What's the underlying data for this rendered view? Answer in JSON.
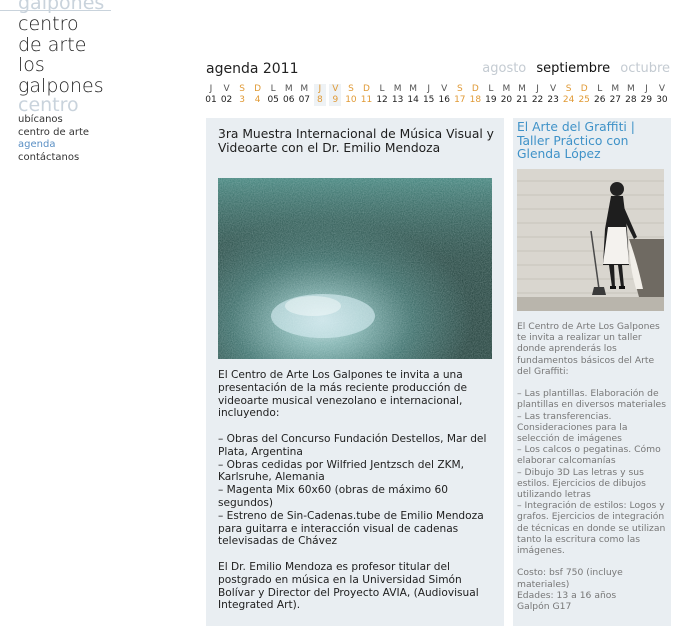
{
  "logo": {
    "ghost_top": "galpones",
    "lines": [
      "centro",
      "de arte",
      "los",
      "galpones"
    ],
    "ghost_bottom": "centro"
  },
  "nav": {
    "items": [
      {
        "label": "ubícanos",
        "active": false
      },
      {
        "label": "centro de arte",
        "active": false
      },
      {
        "label": "agenda",
        "active": true
      },
      {
        "label": "contáctanos",
        "active": false
      }
    ]
  },
  "agenda": {
    "title": "agenda 2011",
    "months": {
      "prev": "agosto",
      "current": "septiembre",
      "next": "octubre"
    },
    "calendar": [
      {
        "w": "J",
        "n": "01"
      },
      {
        "w": "V",
        "n": "02"
      },
      {
        "w": "S",
        "n": "3"
      },
      {
        "w": "D",
        "n": "4"
      },
      {
        "w": "L",
        "n": "05"
      },
      {
        "w": "M",
        "n": "06"
      },
      {
        "w": "M",
        "n": "07"
      },
      {
        "w": "J",
        "n": "8"
      },
      {
        "w": "V",
        "n": "9"
      },
      {
        "w": "S",
        "n": "10"
      },
      {
        "w": "D",
        "n": "11"
      },
      {
        "w": "L",
        "n": "12"
      },
      {
        "w": "M",
        "n": "13"
      },
      {
        "w": "M",
        "n": "14"
      },
      {
        "w": "J",
        "n": "15"
      },
      {
        "w": "V",
        "n": "16"
      },
      {
        "w": "S",
        "n": "17"
      },
      {
        "w": "D",
        "n": "18"
      },
      {
        "w": "L",
        "n": "19"
      },
      {
        "w": "M",
        "n": "20"
      },
      {
        "w": "M",
        "n": "21"
      },
      {
        "w": "J",
        "n": "22"
      },
      {
        "w": "V",
        "n": "23"
      },
      {
        "w": "S",
        "n": "24"
      },
      {
        "w": "D",
        "n": "25"
      },
      {
        "w": "L",
        "n": "26"
      },
      {
        "w": "M",
        "n": "27"
      },
      {
        "w": "M",
        "n": "28"
      },
      {
        "w": "J",
        "n": "29"
      },
      {
        "w": "V",
        "n": "30"
      }
    ]
  },
  "main_event": {
    "title": "3ra Muestra Internacional de Música Visual y Videoarte con el Dr. Emilio Mendoza",
    "body": "El Centro de Arte Los Galpones te invita a una presentación de la más reciente producción de videoarte musical venezolano e internacional, incluyendo:\n\n– Obras del Concurso Fundación Destellos, Mar del Plata, Argentina\n– Obras cedidas por Wilfried Jentzsch del ZKM, Karlsruhe, Alemania\n– Magenta Mix 60x60 (obras de máximo 60 segundos)\n– Estreno de Sin-Cadenas.tube de Emilio Mendoza para guitarra e interacción visual de cadenas televisadas de Chávez\n\nEl Dr. Emilio Mendoza es profesor titular del postgrado en música en la Universidad Simón Bolívar y Director del Proyecto AVIA, (Audiovisual Integrated Art)."
  },
  "side_event": {
    "title": "El Arte del Graffiti | Taller Práctico con Glenda López",
    "body": "El Centro de Arte Los Galpones te invita a realizar un taller donde aprenderás los fundamentos básicos del Arte del Graffiti:\n\n– Las plantillas. Elaboración de plantillas en diversos materiales\n– Las transferencias. Consideraciones para la selección de imágenes\n– Los calcos o pegatinas. Cómo elaborar calcomanías\n– Dibujo 3D Las letras y sus estilos. Ejercicios de dibujos utilizando letras\n– Integración de estilos: Logos y grafos. Ejercicios de integración de técnicas en donde se utilizan tanto la escritura como las imágenes.\n\nCosto: bsf 750 (incluye materiales)\nEdades: 13 a 16 años\nGalpón G17"
  },
  "colors": {
    "accent_blue": "#3f92c8",
    "weekend_orange": "#e09a36",
    "card_bg": "#e9eef2",
    "ghost_gray": "#c9d3dc"
  }
}
